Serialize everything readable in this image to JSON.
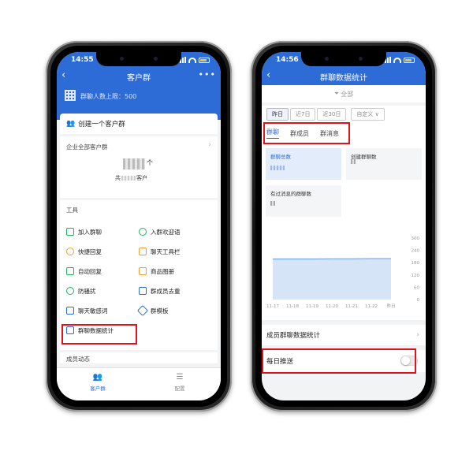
{
  "left": {
    "status": {
      "time": "14:55"
    },
    "nav": {
      "title": "客户群",
      "back": "‹",
      "more": "•••"
    },
    "hero": {
      "limit_text": "群聊人数上限：500"
    },
    "create": {
      "label": "创建一个客户群"
    },
    "all_customers": {
      "title": "企业全部客户群",
      "unit": "个",
      "total_prefix": "共",
      "total_suffix": "客户"
    },
    "tools": {
      "title": "工具",
      "items": [
        {
          "label": "加入群聊",
          "icon": "qr-join-icon"
        },
        {
          "label": "入群欢迎语",
          "icon": "welcome-icon"
        },
        {
          "label": "快捷回复",
          "icon": "quick-reply-icon"
        },
        {
          "label": "聊天工具栏",
          "icon": "toolbar-icon"
        },
        {
          "label": "自动回复",
          "icon": "auto-reply-icon"
        },
        {
          "label": "商品图册",
          "icon": "catalog-icon"
        },
        {
          "label": "防骚扰",
          "icon": "anti-harass-icon"
        },
        {
          "label": "群成员去重",
          "icon": "dedupe-icon"
        },
        {
          "label": "聊天敏感词",
          "icon": "sensitive-words-icon"
        },
        {
          "label": "群模板",
          "icon": "template-icon"
        },
        {
          "label": "群聊数据统计",
          "icon": "stats-icon"
        }
      ]
    },
    "members": {
      "title": "成员动态"
    },
    "tabbar": {
      "tabs": [
        {
          "label": "客户群"
        },
        {
          "label": "配置"
        }
      ]
    }
  },
  "right": {
    "status": {
      "time": "14:56"
    },
    "nav": {
      "title": "群聊数据统计",
      "back": "‹"
    },
    "filter": {
      "label": "全部"
    },
    "dates": {
      "items": [
        "昨日",
        "近7日",
        "近30日"
      ],
      "custom": "自定义 ∨"
    },
    "tabs": [
      "群聊",
      "群成员",
      "群消息"
    ],
    "stats": [
      {
        "label": "群聊总数"
      },
      {
        "label": "创建群聊数"
      },
      {
        "label": "有过消息的群聊数"
      }
    ],
    "member_stats": {
      "label": "成员群聊数据统计"
    },
    "push": {
      "label": "每日推送"
    },
    "chart_data": {
      "type": "area",
      "x": [
        "11-17",
        "11-18",
        "11-19",
        "11-20",
        "11-21",
        "11-22",
        "昨日"
      ],
      "series": [
        {
          "values": [
            198,
            198,
            198,
            199,
            199,
            200,
            200
          ]
        }
      ],
      "yticks": [
        "300",
        "240",
        "180",
        "120",
        "60",
        "0"
      ],
      "ylim": [
        0,
        300
      ],
      "grid": false,
      "colors": {
        "line": "#6a9be8",
        "fill": "#d6e4f8"
      }
    }
  },
  "colors": {
    "brand": "#2d6bd6",
    "highlight": "#e0121e",
    "green": "#1aad19"
  }
}
